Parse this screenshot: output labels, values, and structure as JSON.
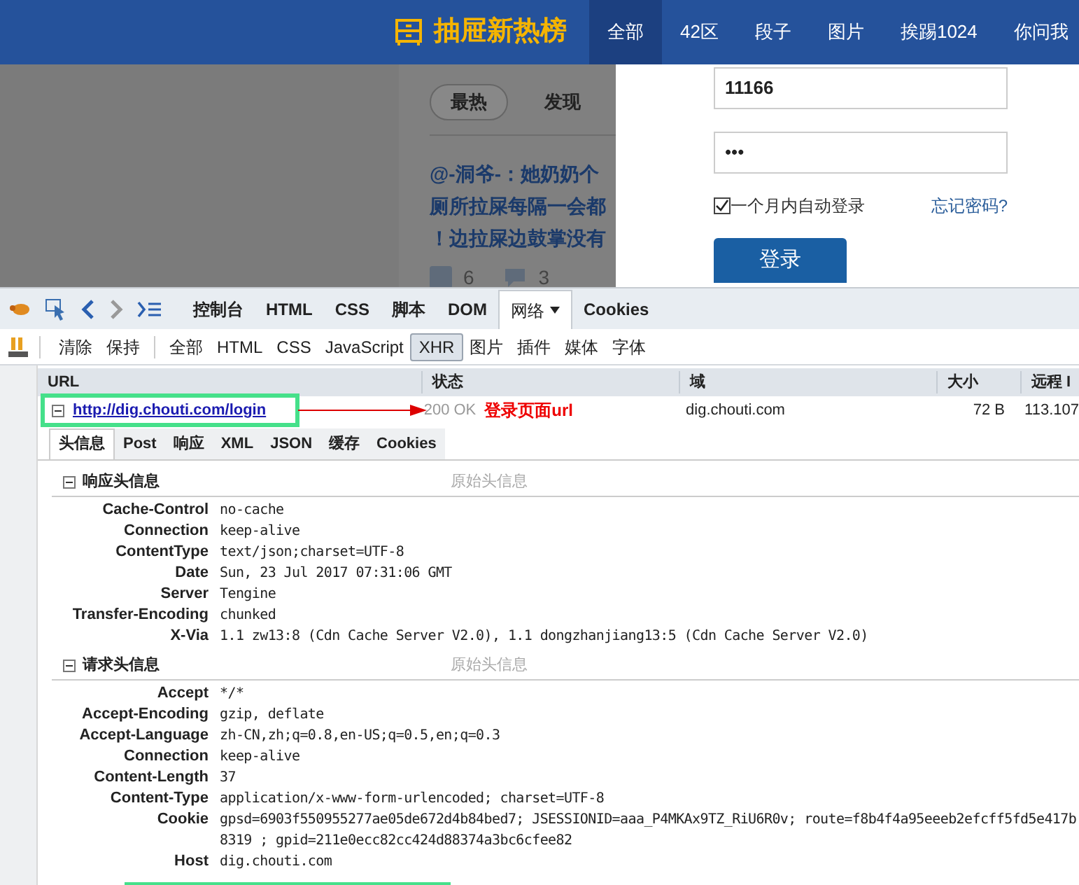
{
  "site": {
    "logo_text": "抽屉新热榜",
    "nav_items": [
      {
        "label": "全部",
        "selected": true
      },
      {
        "label": "42区",
        "selected": false
      },
      {
        "label": "段子",
        "selected": false
      },
      {
        "label": "图片",
        "selected": false
      },
      {
        "label": "挨踢1024",
        "selected": false
      },
      {
        "label": "你问我",
        "selected": false
      }
    ],
    "feed_tabs": [
      {
        "label": "最热",
        "selected": true
      },
      {
        "label": "发现",
        "selected": false
      }
    ],
    "post_lines": [
      "@-洞爷-：她奶奶个",
      "厕所拉屎每隔一会都",
      "！边拉屎边鼓掌没有"
    ],
    "like_count": "6",
    "comment_count": "3",
    "login": {
      "username": "11166",
      "password": "•••",
      "remember": {
        "label": "一个月内自动登录",
        "checked": true
      },
      "forgot_link": "忘记密码?",
      "submit": "登录"
    }
  },
  "devtools": {
    "panel_tabs": [
      {
        "label": "控制台",
        "selected": false
      },
      {
        "label": "HTML",
        "selected": false
      },
      {
        "label": "CSS",
        "selected": false
      },
      {
        "label": "脚本",
        "selected": false
      },
      {
        "label": "DOM",
        "selected": false
      },
      {
        "label": "网络",
        "selected": true
      },
      {
        "label": "Cookies",
        "selected": false
      }
    ],
    "actions": [
      "清除",
      "保持"
    ],
    "filters": [
      {
        "label": "全部",
        "selected": false
      },
      {
        "label": "HTML",
        "selected": false
      },
      {
        "label": "CSS",
        "selected": false
      },
      {
        "label": "JavaScript",
        "selected": false
      },
      {
        "label": "XHR",
        "selected": true
      },
      {
        "label": "图片",
        "selected": false
      },
      {
        "label": "插件",
        "selected": false
      },
      {
        "label": "媒体",
        "selected": false
      },
      {
        "label": "字体",
        "selected": false
      }
    ],
    "columns": [
      "URL",
      "状态",
      "域",
      "大小",
      "远程 I"
    ],
    "request": {
      "url": "http://dig.chouti.com/login",
      "status": "200 OK",
      "domain": "dig.chouti.com",
      "size": "72 B",
      "remote_ip": "113.107",
      "expanded": true
    },
    "url_annotation": "登录页面url",
    "detail_tabs": [
      {
        "label": "头信息",
        "selected": true
      },
      {
        "label": "Post",
        "selected": false
      },
      {
        "label": "响应",
        "selected": false
      },
      {
        "label": "XML",
        "selected": false
      },
      {
        "label": "JSON",
        "selected": false
      },
      {
        "label": "缓存",
        "selected": false
      },
      {
        "label": "Cookies",
        "selected": false
      }
    ],
    "sections": [
      {
        "title": "响应头信息",
        "raw_label": "原始头信息",
        "expanded": true,
        "rows": [
          {
            "name": "Cache-Control",
            "value": "no-cache"
          },
          {
            "name": "Connection",
            "value": "keep-alive"
          },
          {
            "name": "ContentType",
            "value": "text/json;charset=UTF-8"
          },
          {
            "name": "Date",
            "value": "Sun, 23 Jul 2017 07:31:06 GMT"
          },
          {
            "name": "Server",
            "value": "Tengine"
          },
          {
            "name": "Transfer-Encoding",
            "value": "chunked"
          },
          {
            "name": "X-Via",
            "value": "1.1 zw13:8 (Cdn Cache Server V2.0), 1.1 dongzhanjiang13:5 (Cdn Cache Server V2.0)"
          }
        ]
      },
      {
        "title": "请求头信息",
        "raw_label": "原始头信息",
        "expanded": true,
        "rows": [
          {
            "name": "Accept",
            "value": "*/*"
          },
          {
            "name": "Accept-Encoding",
            "value": "gzip, deflate"
          },
          {
            "name": "Accept-Language",
            "value": "zh-CN,zh;q=0.8,en-US;q=0.5,en;q=0.3"
          },
          {
            "name": "Connection",
            "value": "keep-alive"
          },
          {
            "name": "Content-Length",
            "value": "37"
          },
          {
            "name": "Content-Type",
            "value": "application/x-www-form-urlencoded; charset=UTF-8"
          },
          {
            "name": "Cookie",
            "value": "gpsd=6903f550955277ae05de672d4b84bed7; JSESSIONID=aaa_P4MKAx9TZ_RiU6R0v; route=f8b4f4a95eeeb2efcff5fd5e417b8319 ; gpid=211e0ecc82cc424d88374a3bc6cfee82"
          },
          {
            "name": "Host",
            "value": "dig.chouti.com"
          }
        ]
      }
    ],
    "referer_marker": true
  }
}
